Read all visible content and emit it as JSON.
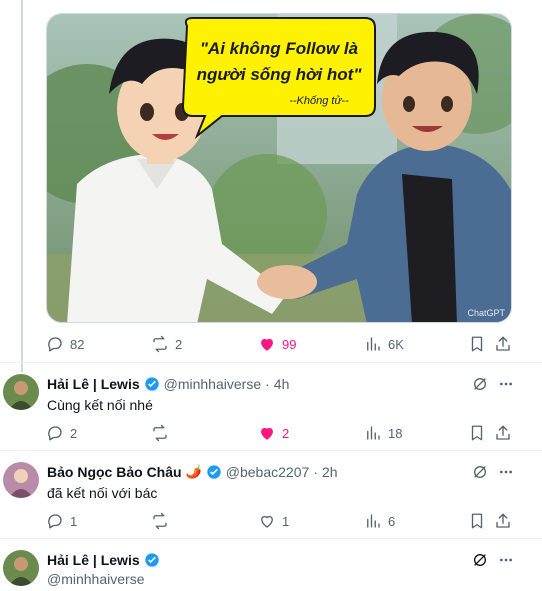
{
  "image": {
    "bubble_line1": "\"Ai không Follow là",
    "bubble_line2": "người sống hời hot\"",
    "bubble_signature": "--Khống tử--",
    "watermark": "ChatGPT"
  },
  "post": {
    "reply_count": "82",
    "retweet_count": "2",
    "like_count": "99",
    "view_count": "6K"
  },
  "replies": [
    {
      "name": "Hải Lê | Lewis",
      "handle": "@minhhaiverse",
      "dot": "·",
      "time": "4h",
      "text": "Cùng kết nối nhé",
      "reply_count": "2",
      "retweet_count": "",
      "like_count": "2",
      "view_count": "18",
      "liked": true
    },
    {
      "name": "Bảo Ngọc Bảo Châu",
      "emoji": "🌶️",
      "handle": "@bebac2207",
      "dot": "·",
      "time": "2h",
      "text": "đã kết nối với bác",
      "reply_count": "1",
      "retweet_count": "",
      "like_count": "1",
      "view_count": "6",
      "liked": false
    },
    {
      "name": "Hải Lê | Lewis",
      "handle": "@minhhaiverse"
    }
  ],
  "colors": {
    "accent": "#1d9bf0",
    "like": "#f91880",
    "muted": "#536471",
    "bubble": "#fff200"
  },
  "icons": [
    "reply-icon",
    "retweet-icon",
    "heart-icon",
    "views-icon",
    "bookmark-icon",
    "share-icon",
    "grok-icon",
    "more-icon",
    "verified-icon"
  ]
}
